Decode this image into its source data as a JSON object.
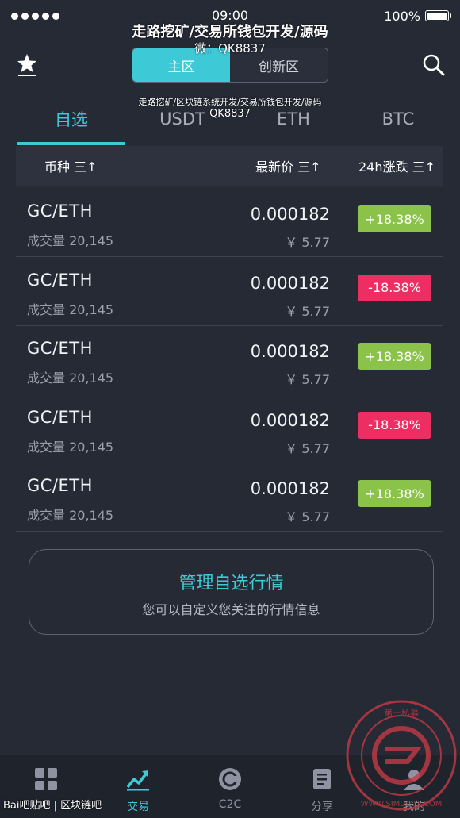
{
  "status_bar": {
    "time": "09:00",
    "battery": "100%"
  },
  "watermark": {
    "line1": "走路挖矿/交易所钱包开发/源码",
    "line2": "微：QK8837",
    "line3": "走路挖矿/区块链系统开发/交易所钱包开发/源码",
    "line4": "QK8837",
    "baidu": "Bai吧贴吧 | 区块链吧"
  },
  "header": {
    "segments": [
      "主区",
      "创新区"
    ],
    "active_segment": 0
  },
  "tabs": [
    "自选",
    "USDT",
    "ETH",
    "BTC"
  ],
  "columns": {
    "coin": "币种 三↑",
    "price": "最新价 三↑",
    "change": "24h涨跌 三↑"
  },
  "rows": [
    {
      "pair": "GC/ETH",
      "volume": "成交量 20,145",
      "price": "0.000182",
      "cny": "￥ 5.77",
      "change": "+18.38%",
      "direction": "up"
    },
    {
      "pair": "GC/ETH",
      "volume": "成交量 20,145",
      "price": "0.000182",
      "cny": "￥ 5.77",
      "change": "-18.38%",
      "direction": "down"
    },
    {
      "pair": "GC/ETH",
      "volume": "成交量 20,145",
      "price": "0.000182",
      "cny": "￥ 5.77",
      "change": "+18.38%",
      "direction": "up"
    },
    {
      "pair": "GC/ETH",
      "volume": "成交量 20,145",
      "price": "0.000182",
      "cny": "￥ 5.77",
      "change": "-18.38%",
      "direction": "down"
    },
    {
      "pair": "GC/ETH",
      "volume": "成交量 20,145",
      "price": "0.000182",
      "cny": "￥ 5.77",
      "change": "+18.38%",
      "direction": "up"
    }
  ],
  "manage_card": {
    "title": "管理自选行情",
    "subtitle": "您可以自定义您关注的行情信息"
  },
  "bottom_nav": [
    {
      "label": "",
      "icon": "grid-icon"
    },
    {
      "label": "交易",
      "icon": "chart-icon"
    },
    {
      "label": "C2C",
      "icon": "c2c-icon"
    },
    {
      "label": "分享",
      "icon": "book-icon"
    },
    {
      "label": "我的",
      "icon": "user-icon"
    }
  ],
  "stamp_text": "第一私募 WWW.SIMU001.COM",
  "colors": {
    "accent": "#3dc9d6",
    "up": "#8bc34a",
    "down": "#ec2e62",
    "bg": "#252a35"
  }
}
